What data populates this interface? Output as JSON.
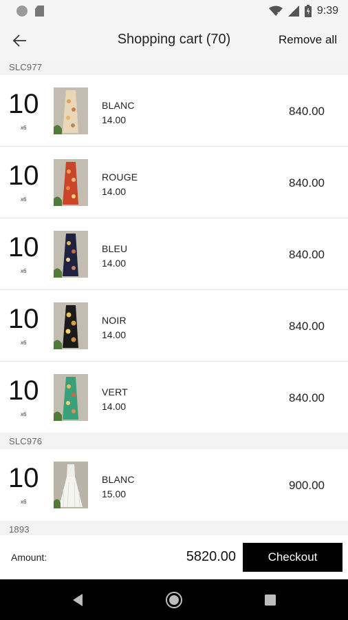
{
  "status_bar": {
    "time": "9:39"
  },
  "app_bar": {
    "title": "Shopping cart (70)",
    "remove_all": "Remove all"
  },
  "groups": [
    {
      "code": "SLC977"
    },
    {
      "code": "SLC976"
    },
    {
      "code": "1893"
    }
  ],
  "items": [
    {
      "qty": "10",
      "pack": "x6",
      "color": "BLANC",
      "unit_price": "14.00",
      "total": "840.00"
    },
    {
      "qty": "10",
      "pack": "x6",
      "color": "ROUGE",
      "unit_price": "14.00",
      "total": "840.00"
    },
    {
      "qty": "10",
      "pack": "x6",
      "color": "BLEU",
      "unit_price": "14.00",
      "total": "840.00"
    },
    {
      "qty": "10",
      "pack": "x6",
      "color": "NOIR",
      "unit_price": "14.00",
      "total": "840.00"
    },
    {
      "qty": "10",
      "pack": "x6",
      "color": "VERT",
      "unit_price": "14.00",
      "total": "840.00"
    },
    {
      "qty": "10",
      "pack": "x6",
      "color": "BLANC",
      "unit_price": "15.00",
      "total": "900.00"
    }
  ],
  "footer": {
    "amount_label": "Amount:",
    "amount_value": "5820.00",
    "checkout_label": "Checkout"
  },
  "icons": {
    "status": [
      "notification-dot-icon",
      "sd-card-icon",
      "wifi-icon",
      "signal-icon",
      "battery-icon"
    ],
    "nav": [
      "back-triangle-icon",
      "home-circle-icon",
      "recents-square-icon"
    ]
  },
  "colors": {
    "checkout_bg": "#000000",
    "header_bg": "#f5f5f5",
    "row_bg": "#ffffff"
  }
}
